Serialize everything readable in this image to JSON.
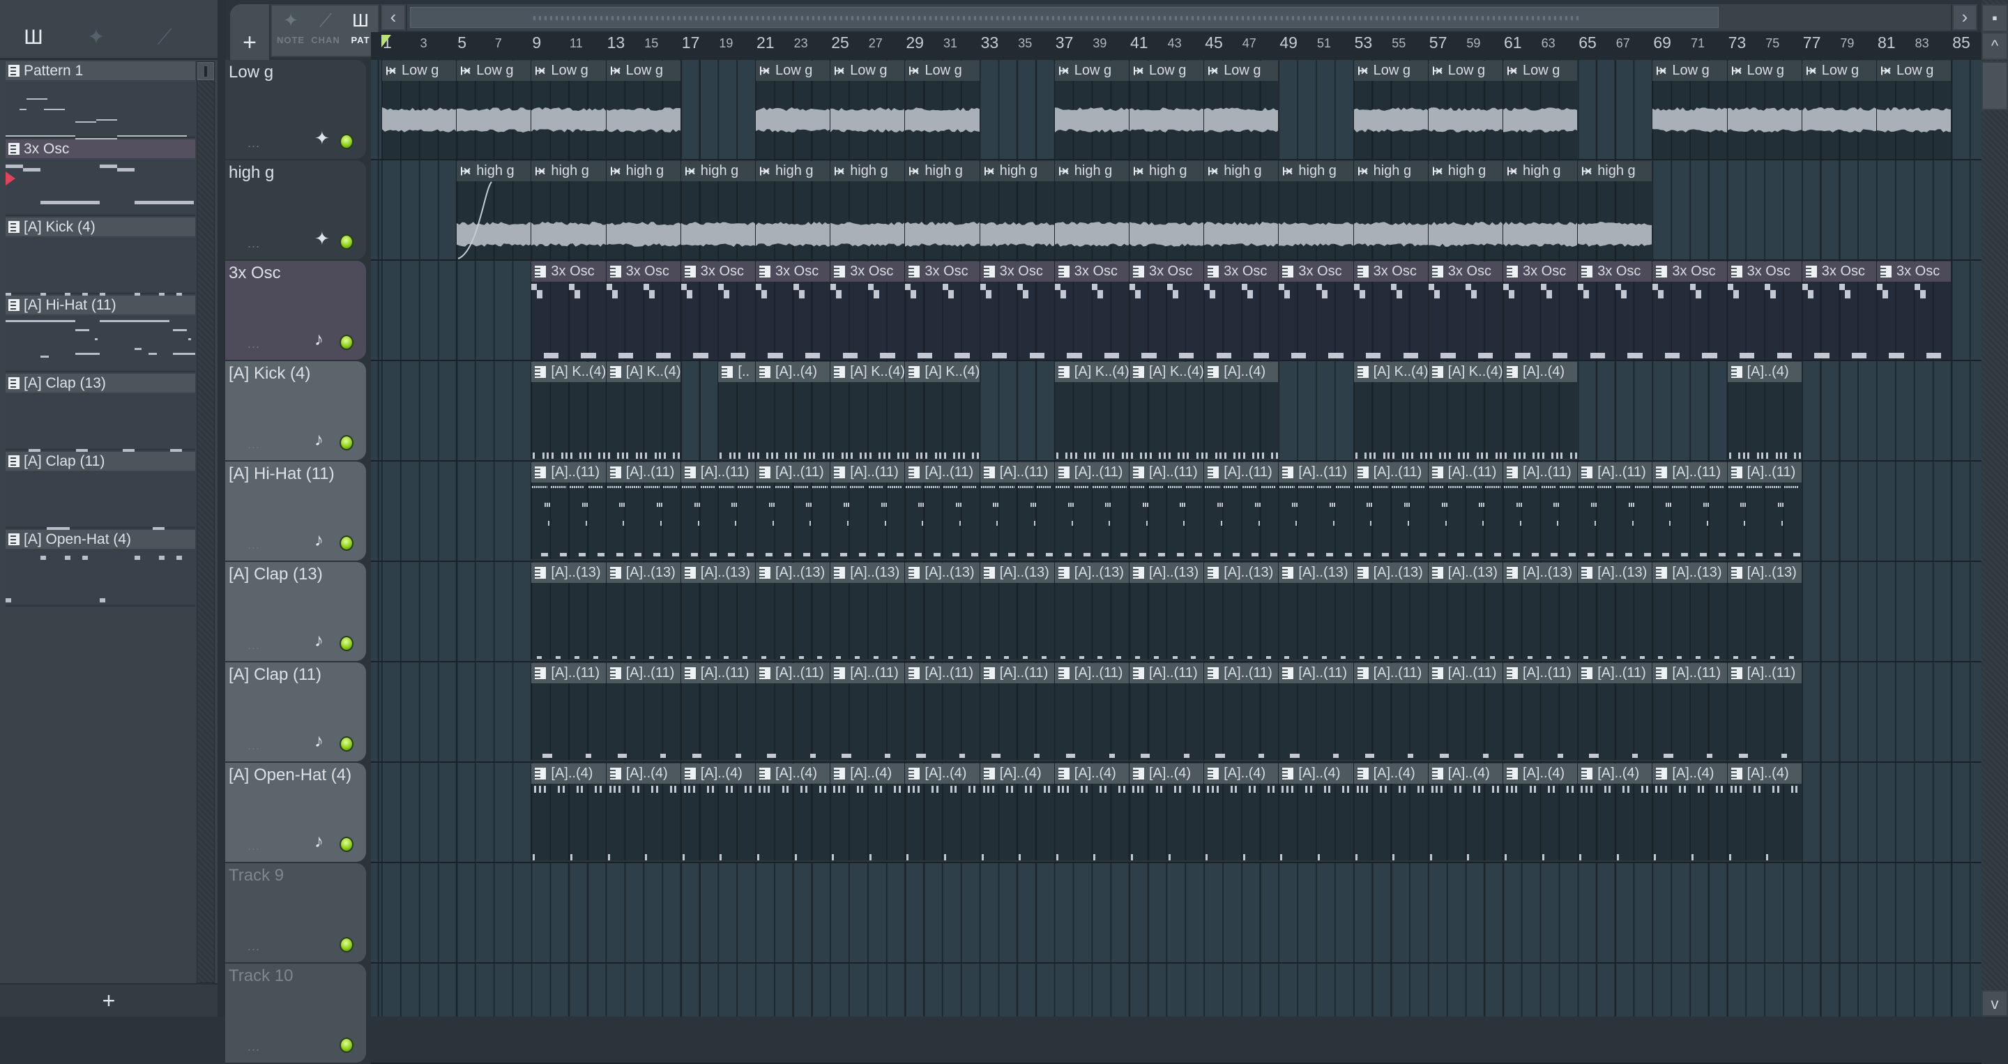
{
  "picker": {
    "tools": [
      {
        "icon": "piano-roll-icon",
        "glyph": "Ш"
      },
      {
        "icon": "audio-clip-icon",
        "glyph": "✦"
      },
      {
        "icon": "automation-icon",
        "glyph": "⟋"
      }
    ],
    "patterns": [
      {
        "label": "Pattern 1",
        "selected": false
      },
      {
        "label": "3x Osc",
        "selected": true
      },
      {
        "label": "[A] Kick (4)",
        "selected": false
      },
      {
        "label": "[A] Hi-Hat (11)",
        "selected": false
      },
      {
        "label": "[A] Clap (13)",
        "selected": false
      },
      {
        "label": "[A] Clap (11)",
        "selected": false
      },
      {
        "label": "[A] Open-Hat (4)",
        "selected": false
      }
    ],
    "add_label": "+"
  },
  "toolbar": {
    "add_label": "+",
    "scroll_left": "‹",
    "scroll_right": "›",
    "modes": [
      {
        "label": "NOTE",
        "glyph": "✦",
        "active": false
      },
      {
        "label": "CHAN",
        "glyph": "⟋",
        "active": false
      },
      {
        "label": "PAT",
        "glyph": "Ш",
        "active": true
      }
    ]
  },
  "ruler": {
    "marks": [
      1,
      3,
      5,
      7,
      9,
      11,
      13,
      15,
      17,
      19,
      21,
      23,
      25,
      27,
      29,
      31,
      33,
      35,
      37,
      39,
      41,
      43,
      45,
      47,
      49,
      51,
      53,
      55,
      57,
      59,
      61,
      63,
      65,
      67,
      69,
      71,
      73,
      75,
      77,
      79,
      81,
      83,
      85
    ]
  },
  "scrollbar": {
    "up": "^",
    "down": "v",
    "top": "▪"
  },
  "tracks": [
    {
      "name": "Low g",
      "kind": "audio",
      "icon": "✦",
      "color": "#363e45",
      "clips": [
        {
          "s": 1,
          "len": 4,
          "label": "Low g"
        },
        {
          "s": 5,
          "len": 4,
          "label": "Low g"
        },
        {
          "s": 9,
          "len": 4,
          "label": "Low g"
        },
        {
          "s": 13,
          "len": 4,
          "label": "Low g"
        },
        {
          "s": 21,
          "len": 4,
          "label": "Low g"
        },
        {
          "s": 25,
          "len": 4,
          "label": "Low g"
        },
        {
          "s": 29,
          "len": 4,
          "label": "Low g"
        },
        {
          "s": 37,
          "len": 4,
          "label": "Low g"
        },
        {
          "s": 41,
          "len": 4,
          "label": "Low g"
        },
        {
          "s": 45,
          "len": 4,
          "label": "Low g"
        },
        {
          "s": 53,
          "len": 4,
          "label": "Low g"
        },
        {
          "s": 57,
          "len": 4,
          "label": "Low g"
        },
        {
          "s": 61,
          "len": 4,
          "label": "Low g"
        },
        {
          "s": 69,
          "len": 4,
          "label": "Low g"
        },
        {
          "s": 73,
          "len": 4,
          "label": "Low g"
        },
        {
          "s": 77,
          "len": 4,
          "label": "Low g"
        },
        {
          "s": 81,
          "len": 4,
          "label": "Low g"
        }
      ]
    },
    {
      "name": "high g",
      "kind": "audio",
      "icon": "✦",
      "color": "#363e45",
      "clips": [
        {
          "s": 5,
          "len": 4,
          "label": "high g"
        },
        {
          "s": 9,
          "len": 4,
          "label": "high g"
        },
        {
          "s": 13,
          "len": 4,
          "label": "high g"
        },
        {
          "s": 17,
          "len": 4,
          "label": "high g"
        },
        {
          "s": 21,
          "len": 4,
          "label": "high g"
        },
        {
          "s": 25,
          "len": 4,
          "label": "high g"
        },
        {
          "s": 29,
          "len": 4,
          "label": "high g"
        },
        {
          "s": 33,
          "len": 4,
          "label": "high g"
        },
        {
          "s": 37,
          "len": 4,
          "label": "high g"
        },
        {
          "s": 41,
          "len": 4,
          "label": "high g"
        },
        {
          "s": 45,
          "len": 4,
          "label": "high g"
        },
        {
          "s": 49,
          "len": 4,
          "label": "high g"
        },
        {
          "s": 53,
          "len": 4,
          "label": "high g"
        },
        {
          "s": 57,
          "len": 4,
          "label": "high g"
        },
        {
          "s": 61,
          "len": 4,
          "label": "high g"
        },
        {
          "s": 65,
          "len": 4,
          "label": "high g"
        }
      ]
    },
    {
      "name": "3x Osc",
      "kind": "osc",
      "icon": "♪",
      "color": "#4e4b5a",
      "clips": [
        {
          "s": 9,
          "len": 4,
          "label": "3x Osc"
        },
        {
          "s": 13,
          "len": 4,
          "label": "3x Osc"
        },
        {
          "s": 17,
          "len": 4,
          "label": "3x Osc"
        },
        {
          "s": 21,
          "len": 4,
          "label": "3x Osc"
        },
        {
          "s": 25,
          "len": 4,
          "label": "3x Osc"
        },
        {
          "s": 29,
          "len": 4,
          "label": "3x Osc"
        },
        {
          "s": 33,
          "len": 4,
          "label": "3x Osc"
        },
        {
          "s": 37,
          "len": 4,
          "label": "3x Osc"
        },
        {
          "s": 41,
          "len": 4,
          "label": "3x Osc"
        },
        {
          "s": 45,
          "len": 4,
          "label": "3x Osc"
        },
        {
          "s": 49,
          "len": 4,
          "label": "3x Osc"
        },
        {
          "s": 53,
          "len": 4,
          "label": "3x Osc"
        },
        {
          "s": 57,
          "len": 4,
          "label": "3x Osc"
        },
        {
          "s": 61,
          "len": 4,
          "label": "3x Osc"
        },
        {
          "s": 65,
          "len": 4,
          "label": "3x Osc"
        },
        {
          "s": 69,
          "len": 4,
          "label": "3x Osc"
        },
        {
          "s": 73,
          "len": 4,
          "label": "3x Osc"
        },
        {
          "s": 77,
          "len": 4,
          "label": "3x Osc"
        },
        {
          "s": 81,
          "len": 4,
          "label": "3x Osc"
        }
      ]
    },
    {
      "name": "[A] Kick (4)",
      "kind": "kick",
      "icon": "♪",
      "color": "#5c646c",
      "clips": [
        {
          "s": 9,
          "len": 4,
          "label": "[A] K..(4)"
        },
        {
          "s": 13,
          "len": 4,
          "label": "[A] K..(4)"
        },
        {
          "s": 19,
          "len": 2,
          "label": "[.."
        },
        {
          "s": 21,
          "len": 4,
          "label": "[A]..(4)"
        },
        {
          "s": 25,
          "len": 4,
          "label": "[A] K..(4)"
        },
        {
          "s": 29,
          "len": 4,
          "label": "[A] K..(4)"
        },
        {
          "s": 37,
          "len": 4,
          "label": "[A] K..(4)"
        },
        {
          "s": 41,
          "len": 4,
          "label": "[A] K..(4)"
        },
        {
          "s": 45,
          "len": 4,
          "label": "[A]..(4)"
        },
        {
          "s": 53,
          "len": 4,
          "label": "[A] K..(4)"
        },
        {
          "s": 57,
          "len": 4,
          "label": "[A] K..(4)"
        },
        {
          "s": 61,
          "len": 4,
          "label": "[A]..(4)"
        },
        {
          "s": 73,
          "len": 4,
          "label": "[A]..(4)"
        }
      ]
    },
    {
      "name": "[A] Hi-Hat (11)",
      "kind": "hihat",
      "icon": "♪",
      "color": "#5c646c",
      "clips": [
        {
          "s": 9,
          "len": 4,
          "label": "[A]..(11)"
        },
        {
          "s": 13,
          "len": 4,
          "label": "[A]..(11)"
        },
        {
          "s": 17,
          "len": 4,
          "label": "[A]..(11)"
        },
        {
          "s": 21,
          "len": 4,
          "label": "[A]..(11)"
        },
        {
          "s": 25,
          "len": 4,
          "label": "[A]..(11)"
        },
        {
          "s": 29,
          "len": 4,
          "label": "[A]..(11)"
        },
        {
          "s": 33,
          "len": 4,
          "label": "[A]..(11)"
        },
        {
          "s": 37,
          "len": 4,
          "label": "[A]..(11)"
        },
        {
          "s": 41,
          "len": 4,
          "label": "[A]..(11)"
        },
        {
          "s": 45,
          "len": 4,
          "label": "[A]..(11)"
        },
        {
          "s": 49,
          "len": 4,
          "label": "[A]..(11)"
        },
        {
          "s": 53,
          "len": 4,
          "label": "[A]..(11)"
        },
        {
          "s": 57,
          "len": 4,
          "label": "[A]..(11)"
        },
        {
          "s": 61,
          "len": 4,
          "label": "[A]..(11)"
        },
        {
          "s": 65,
          "len": 4,
          "label": "[A]..(11)"
        },
        {
          "s": 69,
          "len": 4,
          "label": "[A]..(11)"
        },
        {
          "s": 73,
          "len": 4,
          "label": "[A]..(11)"
        }
      ]
    },
    {
      "name": "[A] Clap (13)",
      "kind": "clap13",
      "icon": "♪",
      "color": "#5c646c",
      "clips": [
        {
          "s": 9,
          "len": 4,
          "label": "[A]..(13)"
        },
        {
          "s": 13,
          "len": 4,
          "label": "[A]..(13)"
        },
        {
          "s": 17,
          "len": 4,
          "label": "[A]..(13)"
        },
        {
          "s": 21,
          "len": 4,
          "label": "[A]..(13)"
        },
        {
          "s": 25,
          "len": 4,
          "label": "[A]..(13)"
        },
        {
          "s": 29,
          "len": 4,
          "label": "[A]..(13)"
        },
        {
          "s": 33,
          "len": 4,
          "label": "[A]..(13)"
        },
        {
          "s": 37,
          "len": 4,
          "label": "[A]..(13)"
        },
        {
          "s": 41,
          "len": 4,
          "label": "[A]..(13)"
        },
        {
          "s": 45,
          "len": 4,
          "label": "[A]..(13)"
        },
        {
          "s": 49,
          "len": 4,
          "label": "[A]..(13)"
        },
        {
          "s": 53,
          "len": 4,
          "label": "[A]..(13)"
        },
        {
          "s": 57,
          "len": 4,
          "label": "[A]..(13)"
        },
        {
          "s": 61,
          "len": 4,
          "label": "[A]..(13)"
        },
        {
          "s": 65,
          "len": 4,
          "label": "[A]..(13)"
        },
        {
          "s": 69,
          "len": 4,
          "label": "[A]..(13)"
        },
        {
          "s": 73,
          "len": 4,
          "label": "[A]..(13)"
        }
      ]
    },
    {
      "name": "[A] Clap (11)",
      "kind": "clap11",
      "icon": "♪",
      "color": "#5c646c",
      "clips": [
        {
          "s": 9,
          "len": 4,
          "label": "[A]..(11)"
        },
        {
          "s": 13,
          "len": 4,
          "label": "[A]..(11)"
        },
        {
          "s": 17,
          "len": 4,
          "label": "[A]..(11)"
        },
        {
          "s": 21,
          "len": 4,
          "label": "[A]..(11)"
        },
        {
          "s": 25,
          "len": 4,
          "label": "[A]..(11)"
        },
        {
          "s": 29,
          "len": 4,
          "label": "[A]..(11)"
        },
        {
          "s": 33,
          "len": 4,
          "label": "[A]..(11)"
        },
        {
          "s": 37,
          "len": 4,
          "label": "[A]..(11)"
        },
        {
          "s": 41,
          "len": 4,
          "label": "[A]..(11)"
        },
        {
          "s": 45,
          "len": 4,
          "label": "[A]..(11)"
        },
        {
          "s": 49,
          "len": 4,
          "label": "[A]..(11)"
        },
        {
          "s": 53,
          "len": 4,
          "label": "[A]..(11)"
        },
        {
          "s": 57,
          "len": 4,
          "label": "[A]..(11)"
        },
        {
          "s": 61,
          "len": 4,
          "label": "[A]..(11)"
        },
        {
          "s": 65,
          "len": 4,
          "label": "[A]..(11)"
        },
        {
          "s": 69,
          "len": 4,
          "label": "[A]..(11)"
        },
        {
          "s": 73,
          "len": 4,
          "label": "[A]..(11)"
        }
      ]
    },
    {
      "name": "[A] Open-Hat (4)",
      "kind": "openhat",
      "icon": "♪",
      "color": "#5c646c",
      "clips": [
        {
          "s": 9,
          "len": 4,
          "label": "[A]..(4)"
        },
        {
          "s": 13,
          "len": 4,
          "label": "[A]..(4)"
        },
        {
          "s": 17,
          "len": 4,
          "label": "[A]..(4)"
        },
        {
          "s": 21,
          "len": 4,
          "label": "[A]..(4)"
        },
        {
          "s": 25,
          "len": 4,
          "label": "[A]..(4)"
        },
        {
          "s": 29,
          "len": 4,
          "label": "[A]..(4)"
        },
        {
          "s": 33,
          "len": 4,
          "label": "[A]..(4)"
        },
        {
          "s": 37,
          "len": 4,
          "label": "[A]..(4)"
        },
        {
          "s": 41,
          "len": 4,
          "label": "[A]..(4)"
        },
        {
          "s": 45,
          "len": 4,
          "label": "[A]..(4)"
        },
        {
          "s": 49,
          "len": 4,
          "label": "[A]..(4)"
        },
        {
          "s": 53,
          "len": 4,
          "label": "[A]..(4)"
        },
        {
          "s": 57,
          "len": 4,
          "label": "[A]..(4)"
        },
        {
          "s": 61,
          "len": 4,
          "label": "[A]..(4)"
        },
        {
          "s": 65,
          "len": 4,
          "label": "[A]..(4)"
        },
        {
          "s": 69,
          "len": 4,
          "label": "[A]..(4)"
        },
        {
          "s": 73,
          "len": 4,
          "label": "[A]..(4)"
        }
      ]
    },
    {
      "name": "Track 9",
      "kind": "empty",
      "icon": "",
      "color": "#4a5259",
      "clips": []
    },
    {
      "name": "Track 10",
      "kind": "empty",
      "icon": "",
      "color": "#4a5259",
      "clips": []
    }
  ],
  "dots": "..."
}
